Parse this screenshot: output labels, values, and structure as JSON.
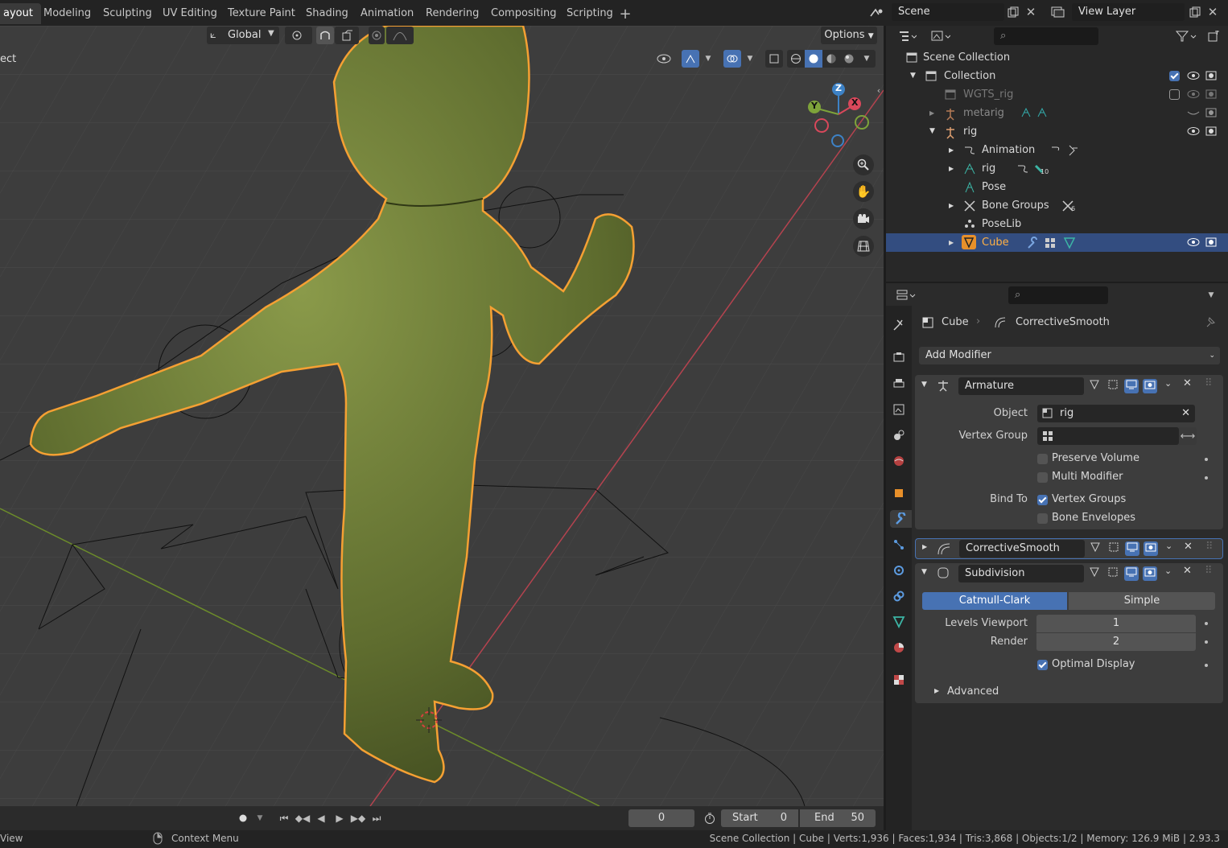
{
  "topbar": {
    "workspaces": [
      "ayout",
      "Modeling",
      "Sculpting",
      "UV Editing",
      "Texture Paint",
      "Shading",
      "Animation",
      "Rendering",
      "Compositing",
      "Scripting"
    ],
    "active_workspace": "ayout",
    "add_tab": "+",
    "scene": "Scene",
    "view_layer": "View Layer"
  },
  "viewport": {
    "transform_orientation": "Global",
    "options_label": "Options",
    "mode_text": "ect",
    "gizmo_axes": {
      "x": "X",
      "y": "Y",
      "z": "Z"
    }
  },
  "outliner": {
    "rows": [
      {
        "label": "Scene Collection"
      },
      {
        "label": "Collection"
      },
      {
        "label": "WGTS_rig"
      },
      {
        "label": "metarig"
      },
      {
        "label": "rig"
      },
      {
        "label": "Animation"
      },
      {
        "label": "rig",
        "badge": "10"
      },
      {
        "label": "Pose"
      },
      {
        "label": "Bone Groups",
        "badge": "6"
      },
      {
        "label": "PoseLib"
      },
      {
        "label": "Cube"
      }
    ]
  },
  "properties": {
    "breadcrumb_object": "Cube",
    "breadcrumb_modifier": "CorrectiveSmooth",
    "add_modifier": "Add Modifier",
    "armature": {
      "name": "Armature",
      "object_label": "Object",
      "object_value": "rig",
      "vertex_group_label": "Vertex Group",
      "preserve_volume": "Preserve Volume",
      "multi_modifier": "Multi Modifier",
      "bind_to_label": "Bind To",
      "vertex_groups": "Vertex Groups",
      "bone_envelopes": "Bone Envelopes"
    },
    "corrective_smooth": {
      "name": "CorrectiveSmooth"
    },
    "subdivision": {
      "name": "Subdivision",
      "catmull_clark": "Catmull-Clark",
      "simple": "Simple",
      "levels_viewport_label": "Levels Viewport",
      "levels_viewport_value": "1",
      "render_label": "Render",
      "render_value": "2",
      "optimal_display": "Optimal Display",
      "advanced": "Advanced"
    }
  },
  "timeline": {
    "current_frame": "0",
    "start_label": "Start",
    "start_value": "0",
    "end_label": "End",
    "end_value": "50"
  },
  "statusbar": {
    "left": "View",
    "context_menu": "Context Menu",
    "stats": "Scene Collection | Cube | Verts:1,936 | Faces:1,934 | Tris:3,868 | Objects:1/2 | Memory: 126.9 MiB | 2.93.3"
  },
  "colors": {
    "accent": "#4772b3",
    "selection_outline": "#f5a033",
    "mesh": "#6b7a37",
    "x_axis": "#d9485b",
    "y_axis": "#7ea33a",
    "z_axis": "#3d82c6"
  }
}
